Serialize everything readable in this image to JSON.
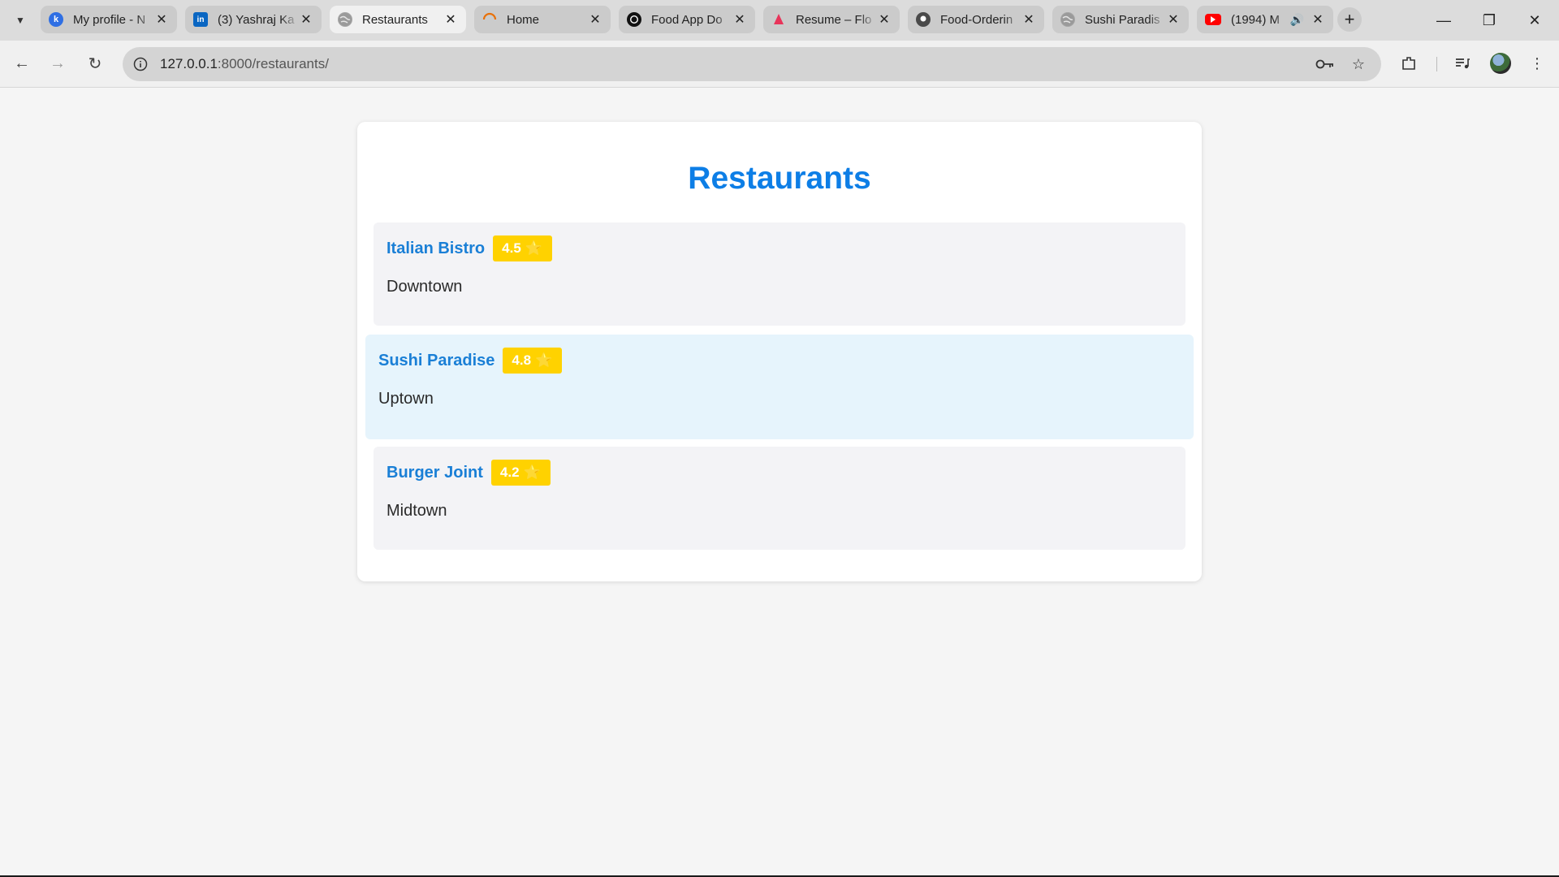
{
  "browser": {
    "tabs": [
      {
        "title": "My profile - N",
        "favicon": "k-logo-icon",
        "color": "#2f6fe4",
        "active": false
      },
      {
        "title": "(3) Yashraj Ka",
        "favicon": "linkedin-icon",
        "color": "#0a66c2",
        "active": false
      },
      {
        "title": "Restaurants",
        "favicon": "globe-icon",
        "color": "#8a8a8a",
        "active": true
      },
      {
        "title": "Home",
        "favicon": "loading-spinner-icon",
        "color": "#e8710a",
        "active": false
      },
      {
        "title": "Food App Do",
        "favicon": "openai-icon",
        "color": "#111111",
        "active": false
      },
      {
        "title": "Resume – Flo",
        "favicon": "flowcv-icon",
        "color": "#e8345a",
        "active": false
      },
      {
        "title": "Food-Orderin",
        "favicon": "github-icon",
        "color": "#333333",
        "active": false
      },
      {
        "title": "Sushi Paradis",
        "favicon": "globe-icon",
        "color": "#8a8a8a",
        "active": false
      },
      {
        "title": "(1994) M",
        "favicon": "youtube-icon",
        "color": "#ff0000",
        "active": false,
        "audio": true
      }
    ],
    "new_tab_icon": "plus-icon",
    "window_controls": [
      "minimize-icon",
      "restore-icon",
      "close-icon"
    ],
    "address": {
      "host": "127.0.0.1",
      "rest": ":8000/restaurants/"
    }
  },
  "page": {
    "title": "Restaurants",
    "accent": "#0d7ee6",
    "badge_color": "#ffd200",
    "restaurants": [
      {
        "name": "Italian Bistro",
        "rating": "4.5",
        "star": "⭐",
        "location": "Downtown"
      },
      {
        "name": "Sushi Paradise",
        "rating": "4.8",
        "star": "⭐",
        "location": "Uptown",
        "hovered": true
      },
      {
        "name": "Burger Joint",
        "rating": "4.2",
        "star": "⭐",
        "location": "Midtown"
      }
    ]
  }
}
